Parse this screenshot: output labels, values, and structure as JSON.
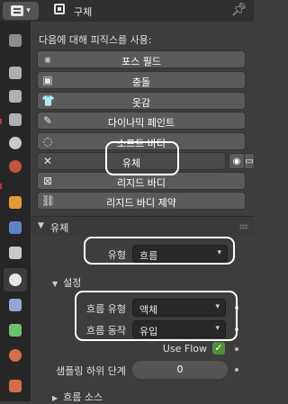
{
  "header": {
    "breadcrumb": "구체"
  },
  "physics": {
    "enable_text": "다음에 대해 피직스를 사용:",
    "buttons": [
      {
        "label": "포스 필드",
        "icon": "force-field-icon",
        "glyph": "⨳"
      },
      {
        "label": "충돌",
        "icon": "collision-icon",
        "glyph": "▣"
      },
      {
        "label": "옷감",
        "icon": "cloth-icon",
        "glyph": "👕"
      },
      {
        "label": "다이나믹 페인트",
        "icon": "dynamic-paint-icon",
        "glyph": "✎"
      },
      {
        "label": "소프트 바디",
        "icon": "soft-body-icon",
        "glyph": "◌"
      },
      {
        "label": "유체",
        "icon": "remove-icon",
        "glyph": "✕"
      },
      {
        "label": "리지드 바디",
        "icon": "rigid-body-icon",
        "glyph": "⊠"
      },
      {
        "label": "리지드 바디 제약",
        "icon": "rigid-constraint-icon",
        "glyph": "⛓"
      }
    ]
  },
  "fluid_panel": {
    "title": "유체",
    "type_label": "유형",
    "type_value": "흐름",
    "settings_title": "설정",
    "flow_type_label": "흐름 유형",
    "flow_type_value": "액체",
    "flow_behavior_label": "흐름 동작",
    "flow_behavior_value": "유입",
    "use_flow_label": "Use Flow",
    "use_flow_checked": true,
    "subframes_label": "샘플링 하위 단계",
    "subframes_value": "0",
    "flow_source_title": "흐름 소스"
  },
  "colors": {
    "accent_check": "#4f8f3a",
    "highlight": "#ffffff"
  }
}
